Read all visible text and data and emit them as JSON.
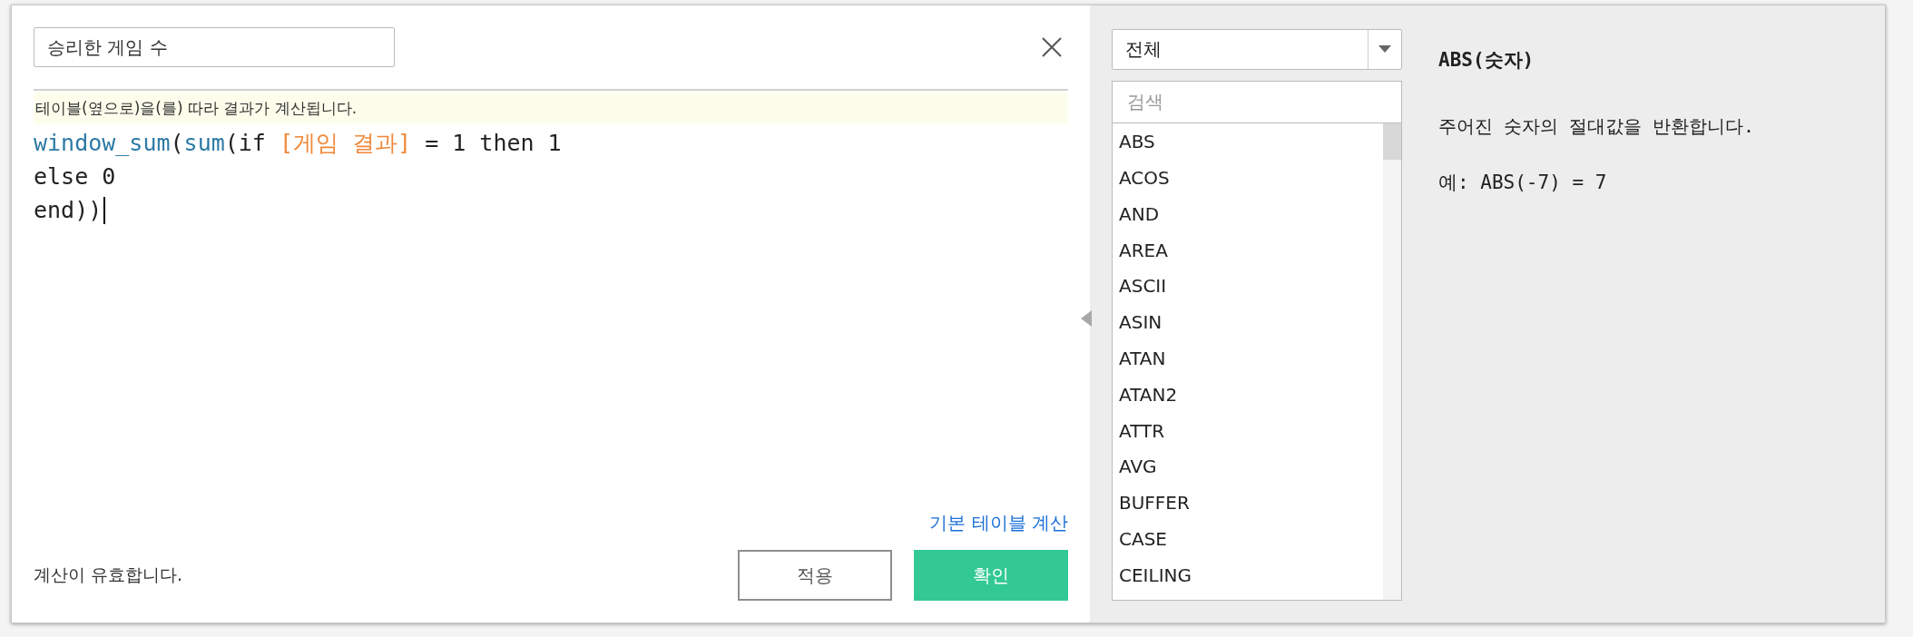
{
  "editor": {
    "name_field": "승리한 게임 수",
    "hint": "테이블(옆으로)을(를) 따라 결과가 계산됩니다.",
    "code": [
      [
        {
          "kind": "function",
          "text": "window_sum"
        },
        {
          "kind": "plain",
          "text": "("
        },
        {
          "kind": "function",
          "text": "sum"
        },
        {
          "kind": "plain",
          "text": "(if "
        },
        {
          "kind": "field",
          "text": "[게임 결과]"
        },
        {
          "kind": "plain",
          "text": " = 1 then 1"
        }
      ],
      [
        {
          "kind": "plain",
          "text": "else 0"
        }
      ],
      [
        {
          "kind": "plain",
          "text": "end))"
        }
      ]
    ],
    "table_calc_link": "기본 테이블 계산",
    "status": "계산이 유효합니다.",
    "buttons": [
      {
        "label": "적용",
        "kind": "secondary"
      },
      {
        "label": "확인",
        "kind": "primary"
      }
    ]
  },
  "reference": {
    "category": "전체",
    "search": {
      "placeholder": "검색"
    },
    "functions": [
      "ABS",
      "ACOS",
      "AND",
      "AREA",
      "ASCII",
      "ASIN",
      "ATAN",
      "ATAN2",
      "ATTR",
      "AVG",
      "BUFFER",
      "CASE",
      "CEILING"
    ],
    "detail": {
      "signature": "ABS(숫자)",
      "description": "주어진 숫자의 절대값을 반환합니다.",
      "example": "예: ABS(-7) = 7"
    }
  }
}
